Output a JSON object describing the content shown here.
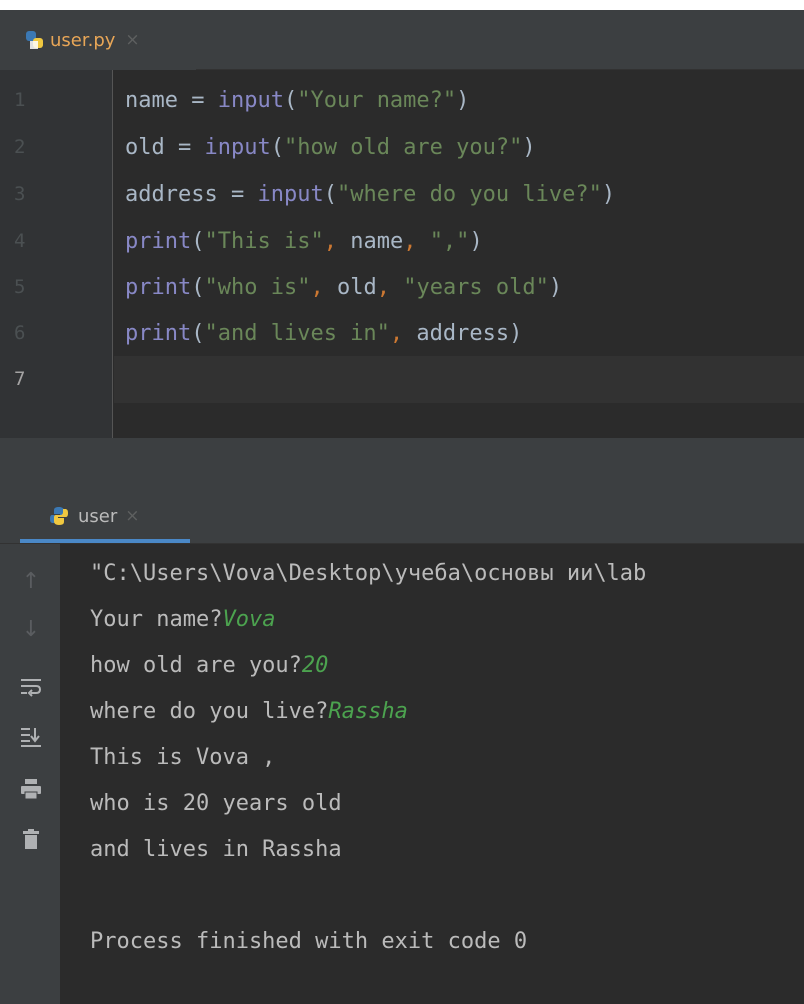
{
  "editor": {
    "tab_label": "user.py",
    "tab_close": "×",
    "line_numbers": [
      "1",
      "2",
      "3",
      "4",
      "5",
      "6",
      "7"
    ],
    "lines": [
      {
        "p": [
          "name",
          " = ",
          "input",
          "(",
          "\"Your name?\"",
          ")"
        ]
      },
      {
        "p": [
          "old",
          " = ",
          "input",
          "(",
          "\"how old are you?\"",
          ")"
        ]
      },
      {
        "p": [
          "address",
          " = ",
          "input",
          "(",
          "\"where do you live?\"",
          ")"
        ]
      },
      {
        "p": [
          "print",
          "(",
          "\"This is\"",
          ", ",
          "name",
          ", ",
          "\",\"",
          ")"
        ]
      },
      {
        "p": [
          "print",
          "(",
          "\"who is\"",
          ", ",
          "old",
          ", ",
          "\"years old\"",
          ")"
        ]
      },
      {
        "p": [
          "print",
          "(",
          "\"and lives in\"",
          ", ",
          "address",
          ")"
        ]
      }
    ]
  },
  "run": {
    "tab_label": "user",
    "tab_close": "×",
    "command": "\"C:\\Users\\Vova\\Desktop\\учеба\\основы ии\\lab",
    "prompts": [
      {
        "prompt": "Your name?",
        "input": "Vova"
      },
      {
        "prompt": "how old are you?",
        "input": "20"
      },
      {
        "prompt": "where do you live?",
        "input": "Rassha"
      }
    ],
    "output": [
      "This is Vova ,",
      "who is 20 years old",
      "and lives in Rassha"
    ],
    "finished": "Process finished with exit code 0",
    "toolbar_icons": [
      "arrow-up-icon",
      "arrow-down-icon",
      "soft-wrap-icon",
      "scroll-to-end-icon",
      "print-icon",
      "trash-icon"
    ]
  },
  "colors": {
    "keyword": "#8888c6",
    "string": "#6a8759",
    "operator": "#cc7832",
    "text": "#a9b7c6",
    "user_input": "#4ca34f",
    "accent": "#4a88c7"
  }
}
